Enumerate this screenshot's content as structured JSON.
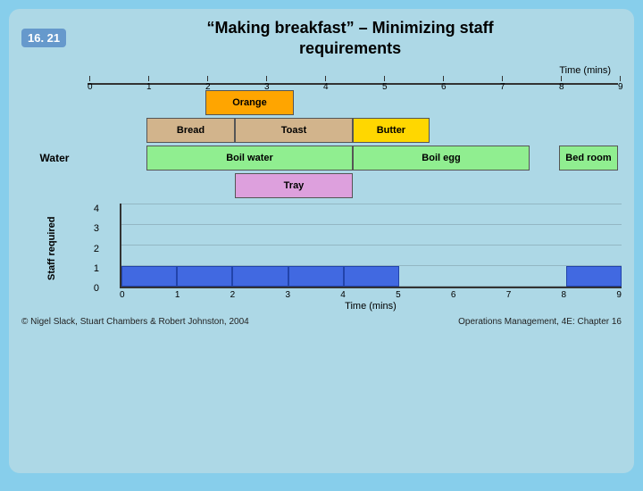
{
  "header": {
    "slide_num": "16. 21",
    "title_line1": "“Making breakfast” – Minimizing staff",
    "title_line2": "requirements"
  },
  "gantt": {
    "time_label": "Time (mins)",
    "axis_ticks": [
      "0",
      "1",
      "2",
      "3",
      "4",
      "5",
      "6",
      "7",
      "8",
      "9"
    ],
    "rows": [
      {
        "label": "",
        "bars": [
          {
            "label": "Orange",
            "start": 2,
            "end": 3.5,
            "color": "#FFA500",
            "text_color": "#000"
          }
        ]
      },
      {
        "label": "",
        "bars": [
          {
            "label": "Bread",
            "start": 1,
            "end": 2.5,
            "color": "#D2B48C",
            "text_color": "#000"
          },
          {
            "label": "Toast",
            "start": 2.5,
            "end": 4.5,
            "color": "#D2B48C",
            "text_color": "#000"
          },
          {
            "label": "Butter",
            "start": 4.5,
            "end": 5.8,
            "color": "#FFD700",
            "text_color": "#000"
          }
        ]
      },
      {
        "label": "Water",
        "bars": [
          {
            "label": "Boil water",
            "start": 1,
            "end": 4.5,
            "color": "#90EE90",
            "text_color": "#000"
          },
          {
            "label": "Boil egg",
            "start": 4.5,
            "end": 7.5,
            "color": "#90EE90",
            "text_color": "#000"
          },
          {
            "label": "Bed room",
            "start": 8,
            "end": 9,
            "color": "#90EE90",
            "text_color": "#000"
          }
        ]
      },
      {
        "label": "",
        "bars": [
          {
            "label": "Tray",
            "start": 2.5,
            "end": 4.5,
            "color": "#DDA0DD",
            "text_color": "#000"
          }
        ]
      }
    ]
  },
  "chart": {
    "y_axis_title": "Staff required",
    "x_axis_title": "Time (mins)",
    "y_labels": [
      "0",
      "1",
      "2",
      "3",
      "4"
    ],
    "x_labels": [
      "0",
      "1",
      "2",
      "3",
      "4",
      "5",
      "6",
      "7",
      "8",
      "9"
    ],
    "bars": [
      {
        "start": 0,
        "end": 1,
        "height": 1
      },
      {
        "start": 1,
        "end": 2,
        "height": 1
      },
      {
        "start": 2,
        "end": 3,
        "height": 1
      },
      {
        "start": 3,
        "end": 4,
        "height": 1
      },
      {
        "start": 4,
        "end": 5,
        "height": 1
      },
      {
        "start": 8,
        "end": 9,
        "height": 1
      }
    ],
    "max_y": 4
  },
  "footer": {
    "left": "© Nigel Slack, Stuart Chambers & Robert Johnston, 2004",
    "right": "Operations Management, 4E: Chapter 16"
  }
}
